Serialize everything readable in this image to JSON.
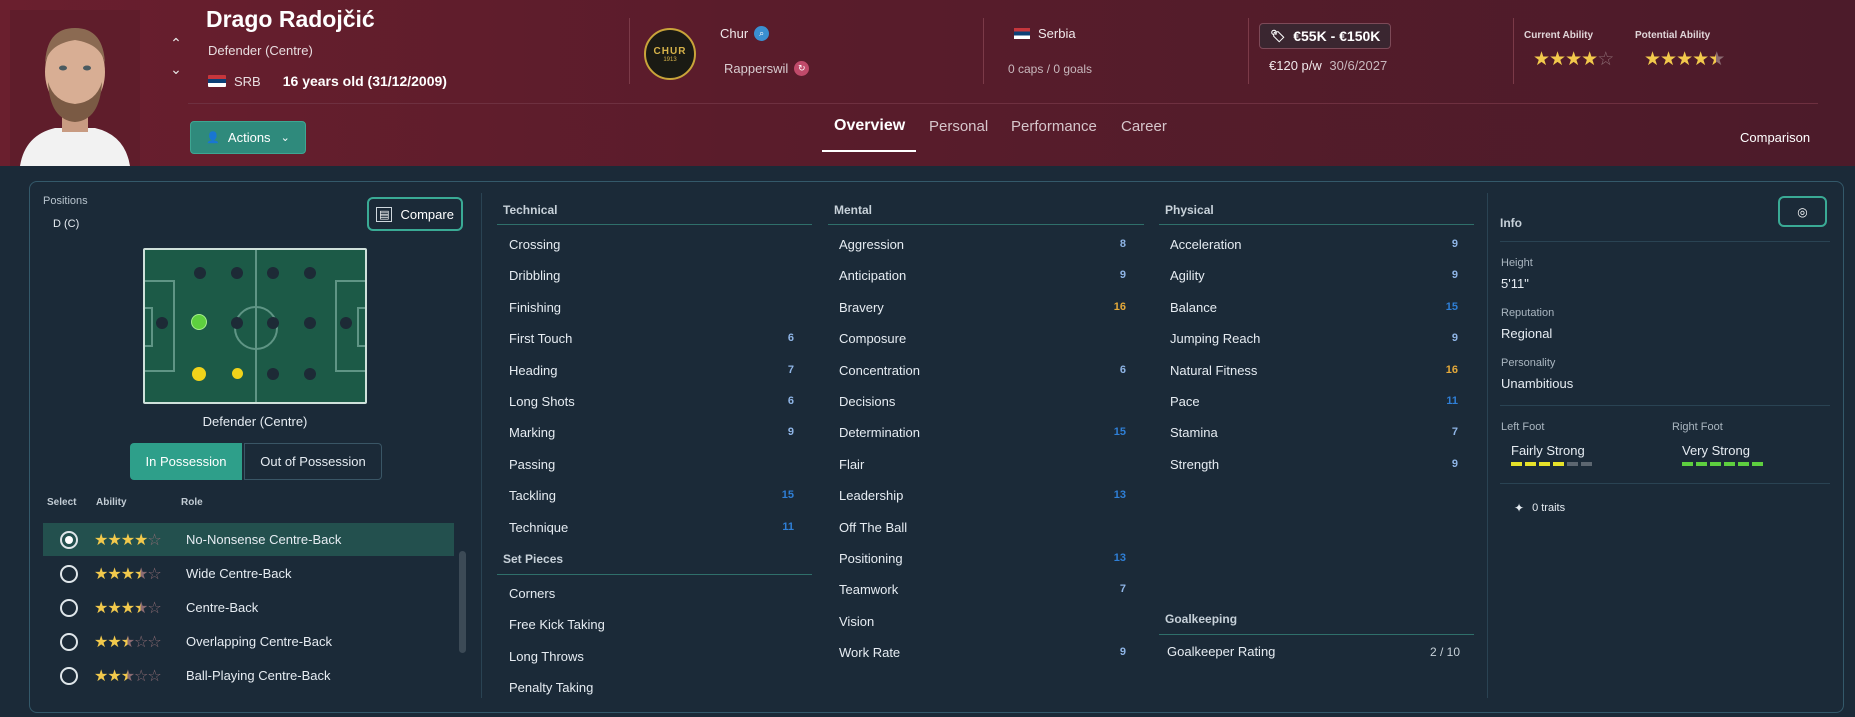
{
  "player": {
    "name": "Drago Radojčić",
    "position": "Defender (Centre)",
    "nation_code": "SRB",
    "age": "16 years old (31/12/2009)"
  },
  "club": {
    "badge_text": "CHUR",
    "badge_year": "1913",
    "name": "Chur",
    "loan_club": "Rapperswil"
  },
  "international": {
    "country": "Serbia",
    "caps": "0 caps / 0 goals"
  },
  "contract": {
    "value": "€55K - €150K",
    "wage": "€120 p/w",
    "expiry": "30/6/2027"
  },
  "ability": {
    "current_label": "Current Ability",
    "current_stars": 4,
    "potential_label": "Potential Ability",
    "potential_stars": 4.5
  },
  "actions_label": "Actions",
  "tabs": [
    {
      "label": "Overview",
      "active": true
    },
    {
      "label": "Personal"
    },
    {
      "label": "Performance"
    },
    {
      "label": "Career"
    }
  ],
  "comparison_label": "Comparison",
  "positions": {
    "label": "Positions",
    "value": "D (C)",
    "compare_label": "Compare",
    "pitch_role": "Defender (Centre)"
  },
  "possession": {
    "in": "In Possession",
    "out": "Out of Possession"
  },
  "roles_header": {
    "select": "Select",
    "ability": "Ability",
    "role": "Role"
  },
  "roles": [
    {
      "name": "No-Nonsense Centre-Back",
      "stars": 4,
      "selected": true
    },
    {
      "name": "Wide Centre-Back",
      "stars": 3.5
    },
    {
      "name": "Centre-Back",
      "stars": 3.5
    },
    {
      "name": "Overlapping Centre-Back",
      "stars": 2.5
    },
    {
      "name": "Ball-Playing Centre-Back",
      "stars": 2.5
    }
  ],
  "technical": {
    "title": "Technical",
    "items": [
      {
        "name": "Crossing",
        "value": ""
      },
      {
        "name": "Dribbling",
        "value": ""
      },
      {
        "name": "Finishing",
        "value": ""
      },
      {
        "name": "First Touch",
        "value": "6"
      },
      {
        "name": "Heading",
        "value": "7"
      },
      {
        "name": "Long Shots",
        "value": "6"
      },
      {
        "name": "Marking",
        "value": "9"
      },
      {
        "name": "Passing",
        "value": ""
      },
      {
        "name": "Tackling",
        "value": "15"
      },
      {
        "name": "Technique",
        "value": "11"
      }
    ]
  },
  "set_pieces": {
    "title": "Set Pieces",
    "items": [
      {
        "name": "Corners",
        "value": ""
      },
      {
        "name": "Free Kick Taking",
        "value": ""
      },
      {
        "name": "Long Throws",
        "value": ""
      },
      {
        "name": "Penalty Taking",
        "value": ""
      }
    ]
  },
  "mental": {
    "title": "Mental",
    "items": [
      {
        "name": "Aggression",
        "value": "8"
      },
      {
        "name": "Anticipation",
        "value": "9"
      },
      {
        "name": "Bravery",
        "value": "16"
      },
      {
        "name": "Composure",
        "value": ""
      },
      {
        "name": "Concentration",
        "value": "6"
      },
      {
        "name": "Decisions",
        "value": ""
      },
      {
        "name": "Determination",
        "value": "15"
      },
      {
        "name": "Flair",
        "value": ""
      },
      {
        "name": "Leadership",
        "value": "13"
      },
      {
        "name": "Off The Ball",
        "value": ""
      },
      {
        "name": "Positioning",
        "value": "13"
      },
      {
        "name": "Teamwork",
        "value": "7"
      },
      {
        "name": "Vision",
        "value": ""
      },
      {
        "name": "Work Rate",
        "value": "9"
      }
    ]
  },
  "physical": {
    "title": "Physical",
    "items": [
      {
        "name": "Acceleration",
        "value": "9"
      },
      {
        "name": "Agility",
        "value": "9"
      },
      {
        "name": "Balance",
        "value": "15"
      },
      {
        "name": "Jumping Reach",
        "value": "9"
      },
      {
        "name": "Natural Fitness",
        "value": "16"
      },
      {
        "name": "Pace",
        "value": "11"
      },
      {
        "name": "Stamina",
        "value": "7"
      },
      {
        "name": "Strength",
        "value": "9"
      }
    ]
  },
  "goalkeeping": {
    "title": "Goalkeeping",
    "rating_label": "Goalkeeper Rating",
    "rating_value": "2 / 10"
  },
  "info": {
    "title": "Info",
    "height_label": "Height",
    "height": "5'11\"",
    "reputation_label": "Reputation",
    "reputation": "Regional",
    "personality_label": "Personality",
    "personality": "Unambitious",
    "left_foot_label": "Left Foot",
    "left_foot": "Fairly Strong",
    "left_foot_level": 4,
    "right_foot_label": "Right Foot",
    "right_foot": "Very Strong",
    "right_foot_level": 6,
    "traits": "0 traits"
  },
  "colors": {
    "accent_teal": "#2e9f8a",
    "star": "#f2c94c",
    "attr_blue": "#2f7fd6",
    "attr_gold": "#e4a93a"
  }
}
